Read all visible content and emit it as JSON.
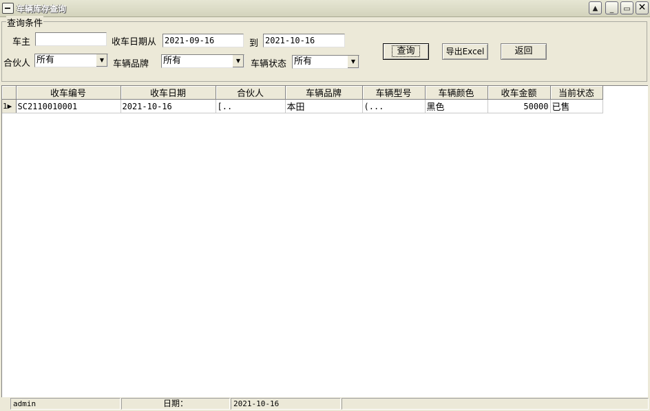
{
  "window": {
    "title": "车辆库存查询",
    "minimize_glyph": "_",
    "restore_glyph": "▭",
    "close_glyph": "✕"
  },
  "query": {
    "group_title": "查询条件",
    "owner_label": "车主",
    "owner_value": "",
    "date_from_label": "收车日期从",
    "date_from_value": "2021-09-16",
    "date_to_label": "到",
    "date_to_value": "2021-10-16",
    "partner_label": "合伙人",
    "partner_value": "所有",
    "brand_label": "车辆品牌",
    "brand_value": "所有",
    "status_label": "车辆状态",
    "status_value": "所有"
  },
  "buttons": {
    "search": "查询",
    "export": "导出Excel",
    "back": "返回"
  },
  "table": {
    "columns": [
      "收车编号",
      "收车日期",
      "合伙人",
      "车辆品牌",
      "车辆型号",
      "车辆颜色",
      "收车金额",
      "当前状态"
    ],
    "rows": [
      {
        "index": "1",
        "row_pointer": "▶",
        "id": "SC2110010001",
        "date": "2021-10-16",
        "partner": "[..",
        "brand": "本田",
        "model": "(...",
        "color": "黑色",
        "amount": "50000",
        "status": "已售"
      }
    ]
  },
  "statusbar": {
    "user": "admin",
    "date_label": "日期：",
    "date_value": "2021-10-16"
  },
  "colors": {
    "chrome": "#ECE9D8",
    "grid_bg": "#FFFFFF"
  }
}
